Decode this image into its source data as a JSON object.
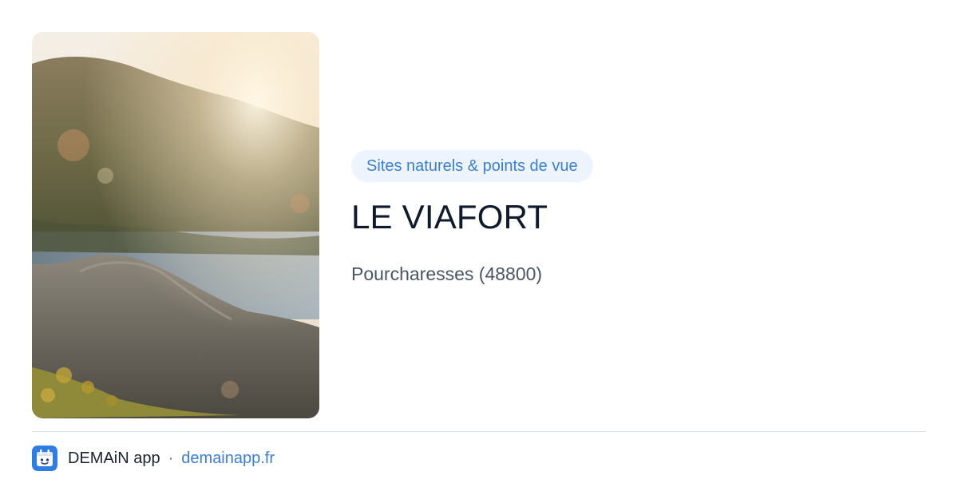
{
  "card": {
    "category": "Sites naturels & points de vue",
    "title": "LE VIAFORT",
    "location": "Pourcharesses (48800)"
  },
  "footer": {
    "app_name": "DEMAiN app",
    "separator": "·",
    "domain": "demainapp.fr",
    "app_icon": "demain-app-icon"
  },
  "photo": {
    "subject": "cover-photo"
  },
  "colors": {
    "accent": "#3b7fd0",
    "badge_background": "#eef4fd",
    "title": "#0f1a2b",
    "location": "#4a5565",
    "divider": "#d9e1e6"
  }
}
